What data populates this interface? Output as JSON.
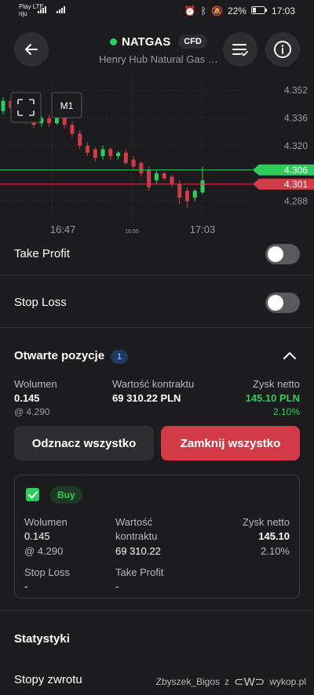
{
  "status": {
    "carrier_top": "Play LTE",
    "carrier_bottom": "nju",
    "battery": "22%",
    "time": "17:03"
  },
  "header": {
    "symbol": "NATGAS",
    "badge": "CFD",
    "subtitle": "Henry Hub Natural Gas …",
    "status_color": "#2ecc5a"
  },
  "chart_data": {
    "type": "candlestick",
    "timeframe_label": "M1",
    "y_ticks": [
      "4.352",
      "4.336",
      "4.320",
      "4.288"
    ],
    "ylim": [
      4.28,
      4.358
    ],
    "x_ticks": [
      "16:47",
      "16:55",
      "17:03"
    ],
    "bid_label": "4.301",
    "ask_label": "4.306",
    "bid_value": 4.301,
    "ask_value": 4.306,
    "bid_color": "#d13b47",
    "ask_color": "#2ecc5a",
    "candles": [
      {
        "o": 4.34,
        "c": 4.346,
        "h": 4.348,
        "l": 4.338
      },
      {
        "o": 4.346,
        "c": 4.342,
        "h": 4.347,
        "l": 4.339
      },
      {
        "o": 4.342,
        "c": 4.338,
        "h": 4.343,
        "l": 4.336
      },
      {
        "o": 4.338,
        "c": 4.335,
        "h": 4.341,
        "l": 4.333
      },
      {
        "o": 4.336,
        "c": 4.332,
        "h": 4.338,
        "l": 4.33
      },
      {
        "o": 4.333,
        "c": 4.336,
        "h": 4.337,
        "l": 4.331
      },
      {
        "o": 4.336,
        "c": 4.333,
        "h": 4.338,
        "l": 4.331
      },
      {
        "o": 4.333,
        "c": 4.336,
        "h": 4.337,
        "l": 4.332
      },
      {
        "o": 4.336,
        "c": 4.332,
        "h": 4.337,
        "l": 4.33
      },
      {
        "o": 4.332,
        "c": 4.327,
        "h": 4.334,
        "l": 4.325
      },
      {
        "o": 4.327,
        "c": 4.32,
        "h": 4.329,
        "l": 4.318
      },
      {
        "o": 4.32,
        "c": 4.316,
        "h": 4.322,
        "l": 4.314
      },
      {
        "o": 4.318,
        "c": 4.313,
        "h": 4.319,
        "l": 4.311
      },
      {
        "o": 4.314,
        "c": 4.318,
        "h": 4.32,
        "l": 4.312
      },
      {
        "o": 4.318,
        "c": 4.314,
        "h": 4.319,
        "l": 4.312
      },
      {
        "o": 4.314,
        "c": 4.316,
        "h": 4.317,
        "l": 4.312
      },
      {
        "o": 4.316,
        "c": 4.31,
        "h": 4.318,
        "l": 4.309
      },
      {
        "o": 4.312,
        "c": 4.308,
        "h": 4.314,
        "l": 4.306
      },
      {
        "o": 4.31,
        "c": 4.304,
        "h": 4.311,
        "l": 4.302
      },
      {
        "o": 4.306,
        "c": 4.296,
        "h": 4.308,
        "l": 4.294
      },
      {
        "o": 4.3,
        "c": 4.304,
        "h": 4.306,
        "l": 4.298
      },
      {
        "o": 4.304,
        "c": 4.301,
        "h": 4.305,
        "l": 4.3
      },
      {
        "o": 4.302,
        "c": 4.298,
        "h": 4.303,
        "l": 4.296
      },
      {
        "o": 4.298,
        "c": 4.29,
        "h": 4.3,
        "l": 4.286
      },
      {
        "o": 4.294,
        "c": 4.288,
        "h": 4.296,
        "l": 4.284
      },
      {
        "o": 4.29,
        "c": 4.294,
        "h": 4.295,
        "l": 4.288
      },
      {
        "o": 4.293,
        "c": 4.3,
        "h": 4.308,
        "l": 4.292
      }
    ]
  },
  "take_profit": {
    "label": "Take Profit"
  },
  "stop_loss": {
    "label": "Stop Loss"
  },
  "positions": {
    "title": "Otwarte pozycje",
    "count": "1",
    "volume_label": "Wolumen",
    "volume_value": "0.145",
    "volume_sub": "@ 4.290",
    "contract_label": "Wartość kontraktu",
    "contract_value": "69 310.22 PLN",
    "profit_label": "Zysk netto",
    "profit_value": "145.10 PLN",
    "profit_pct": "2.10%",
    "deselect_all": "Odznacz wszystko",
    "close_all": "Zamknij wszystko"
  },
  "card": {
    "side": "Buy",
    "volume_label": "Wolumen",
    "volume_value": "0.145",
    "volume_sub": "@ 4.290",
    "contract_label_1": "Wartość",
    "contract_label_2": "kontraktu",
    "contract_value": "69 310.22",
    "profit_label": "Zysk netto",
    "profit_value": "145.10",
    "profit_pct": "2.10%",
    "stop_loss_label": "Stop Loss",
    "stop_loss_value": "-",
    "take_profit_label": "Take Profit",
    "take_profit_value": "-"
  },
  "stats": {
    "title": "Statystyki",
    "next_row": "Stopy zwrotu"
  },
  "watermark": {
    "user": "Zbyszek_Bigos",
    "z": "z",
    "site": "wykop.pl"
  }
}
